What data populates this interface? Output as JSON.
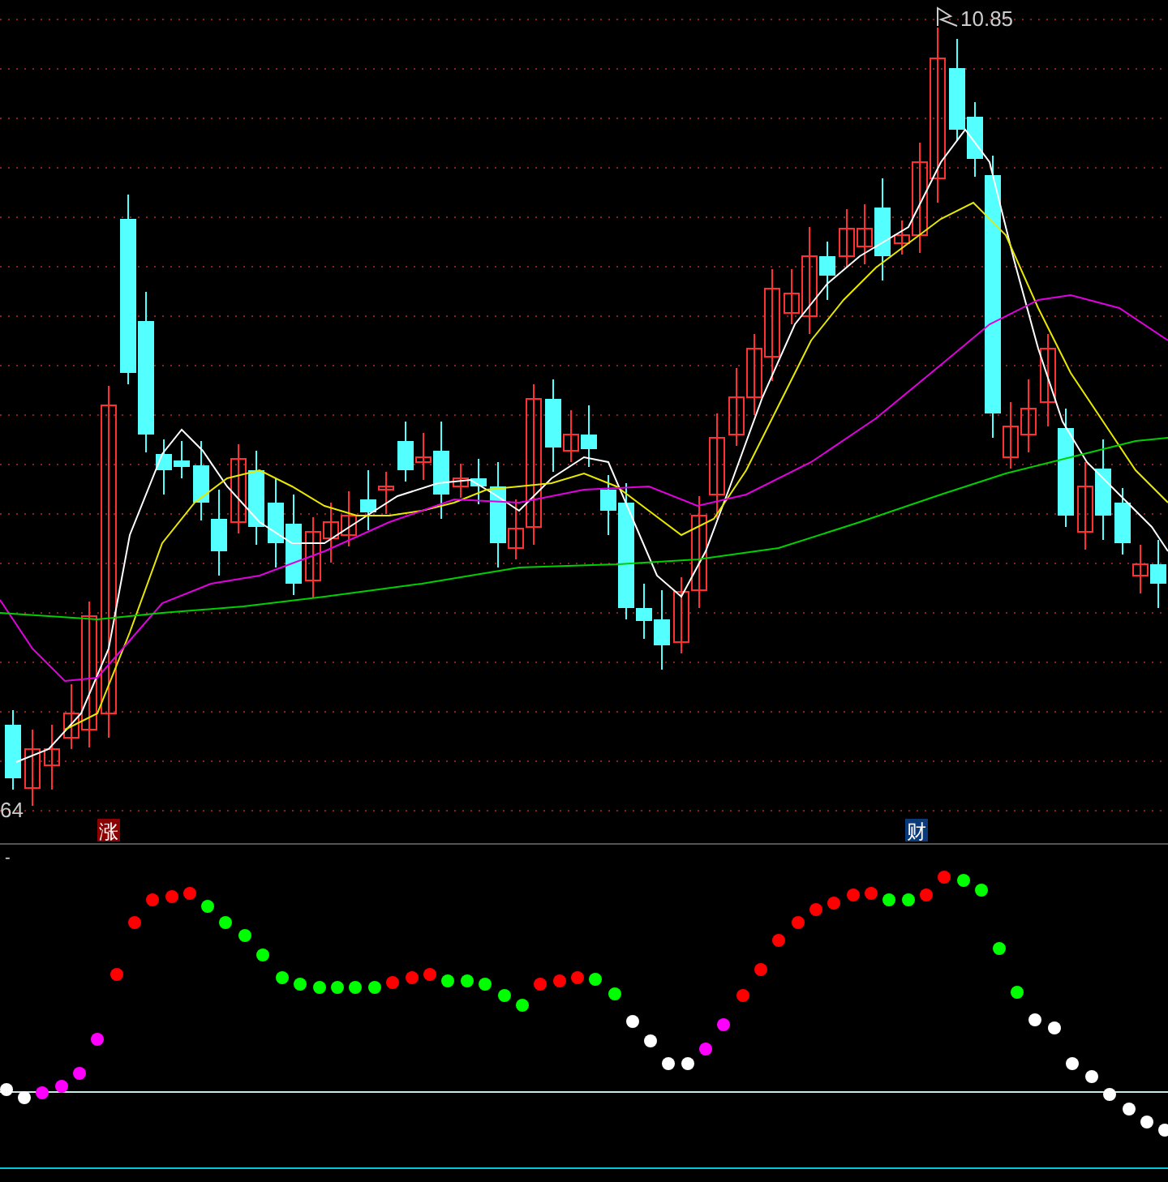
{
  "price_chart": {
    "high_price_label": "10.85",
    "low_price_label": "64"
  },
  "markers": [
    {
      "kind": "rise",
      "text": "涨"
    },
    {
      "kind": "finance",
      "text": "财"
    }
  ],
  "indicator_panel": {
    "label": "-"
  }
}
